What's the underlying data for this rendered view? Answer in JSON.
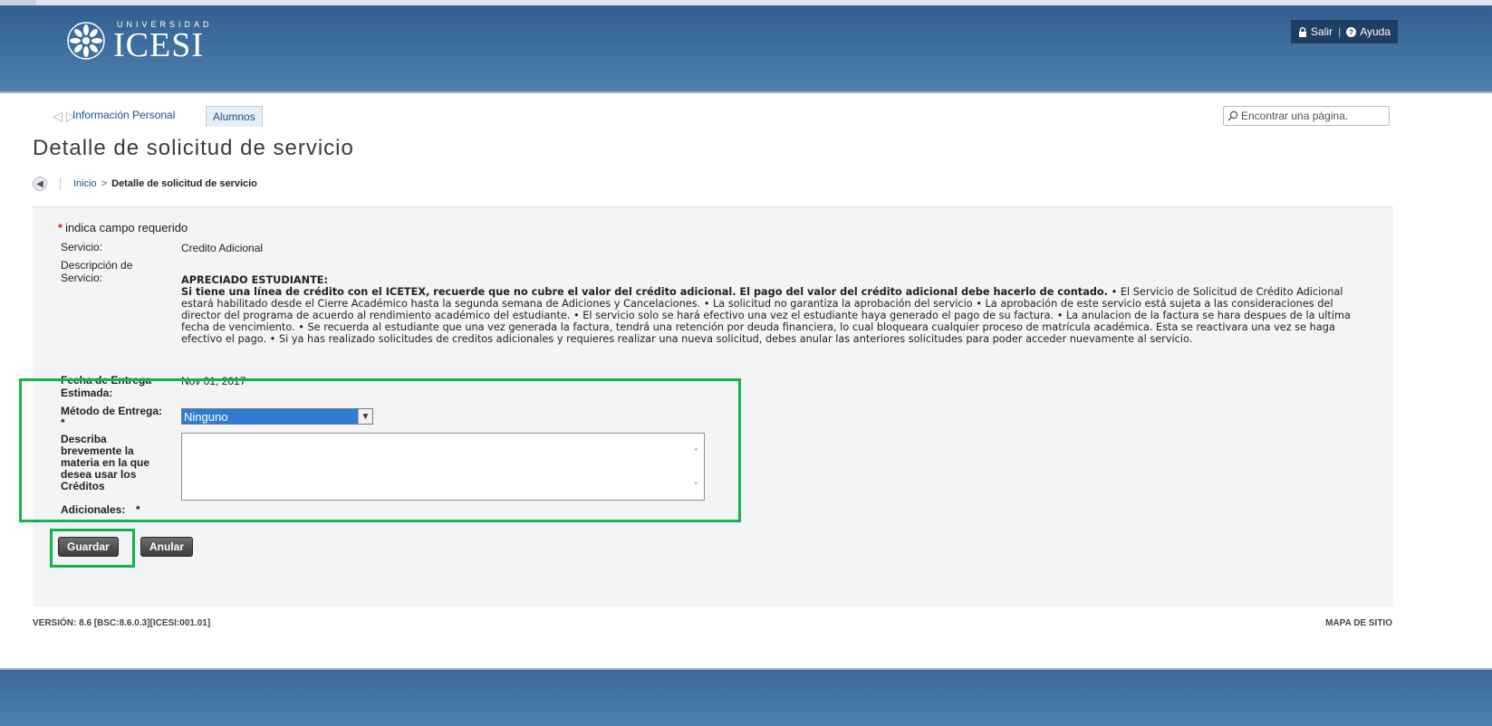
{
  "header": {
    "logo_top": "UNIVERSIDAD",
    "logo_main": "ICESI",
    "logout_label": "Salir",
    "help_label": "Ayuda",
    "separator": "|"
  },
  "nav": {
    "tab_info": "Información Personal",
    "tab_alumnos": "Alumnos",
    "search_placeholder": "Encontrar una página."
  },
  "page": {
    "title": "Detalle de solicitud de servicio"
  },
  "breadcrumb": {
    "home": "Inicio",
    "separator": ">",
    "current": "Detalle de solicitud de servicio"
  },
  "form": {
    "required_note": "indica campo requerido",
    "servicio_label": "Servicio:",
    "servicio_value": "Credito Adicional",
    "descripcion_label_1": "Descripción de",
    "descripcion_label_2": "Servicio:",
    "descripcion_heading": "APRECIADO ESTUDIANTE:",
    "descripcion_bold": "Si tiene una línea de crédito con el ICETEX, recuerde que no cubre el valor del crédito adicional. El pago del valor del crédito adicional debe hacerlo de contado.",
    "descripcion_body": " • El Servicio de Solicitud de Crédito Adicional estará habilitado desde el Cierre Académico hasta la segunda semana de Adiciones y Cancelaciones. • La solicitud no garantiza la aprobación del servicio • La aprobación de este servicio está sujeta a las consideraciones del director del programa de acuerdo al rendimiento académico del estudiante. • El servicio solo se hará efectivo una vez el estudiante haya generado el pago de su factura. • La anulacion de la factura se hara despues de la ultima fecha de vencimiento. • Se recuerda al estudiante que una vez generada la factura, tendrá una retención por deuda financiera, lo cual bloqueara cualquier proceso de matrícula académica. Esta se reactivara una vez se haga efectivo el pago. • Si ya has realizado solicitudes de creditos adicionales y requieres realizar una nueva solicitud, debes anular las anteriores solicitudes para poder acceder nuevamente al servicio.",
    "fecha_label_1": "Fecha de Entrega",
    "fecha_label_2": "Estimada:",
    "fecha_value": "Nov 01, 2017",
    "metodo_label": "Método de Entrega:",
    "metodo_value": "Ninguno",
    "materia_label_1": "Describa",
    "materia_label_2": "brevemente la",
    "materia_label_3": "materia en la que",
    "materia_label_4": "desea usar los",
    "materia_label_5": "Créditos",
    "materia_label_6": "Adicionales:",
    "materia_value": ""
  },
  "buttons": {
    "guardar": "Guardar",
    "anular": "Anular"
  },
  "footer": {
    "version": "VERSIÓN: 8.6 [BSC:8.6.0.3][ICESI:001.01]",
    "sitemap": "MAPA DE SITIO"
  },
  "colors": {
    "header_blue": "#3f6f9e",
    "highlight_green": "#17b34a",
    "link_blue": "#1d4f82",
    "required_red": "#d12b2b"
  }
}
